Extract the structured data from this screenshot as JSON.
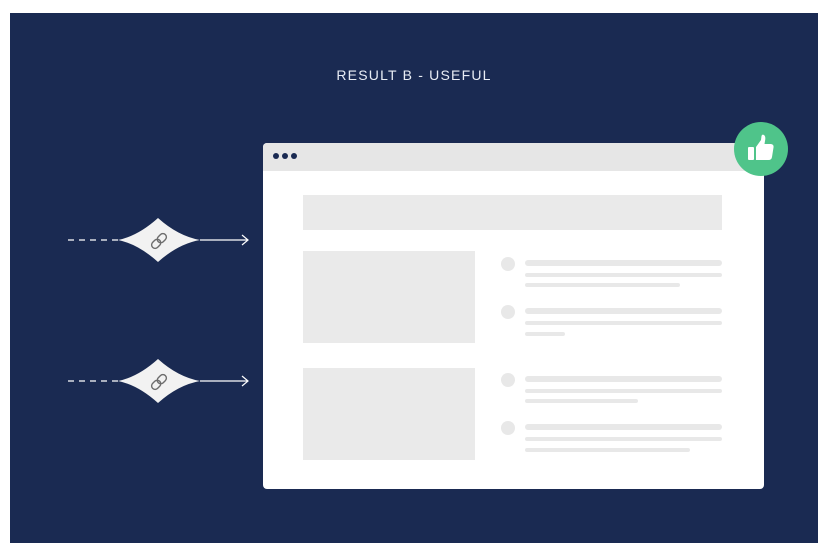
{
  "heading": "RESULT B - USEFUL",
  "colors": {
    "background": "#1a2a52",
    "badge": "#4fc48a",
    "placeholder": "#e8e8e8"
  },
  "badge_icon": "thumbs-up-icon",
  "link_icon": "link-icon",
  "incoming_links": [
    {
      "icon": "link-icon"
    },
    {
      "icon": "link-icon"
    }
  ]
}
